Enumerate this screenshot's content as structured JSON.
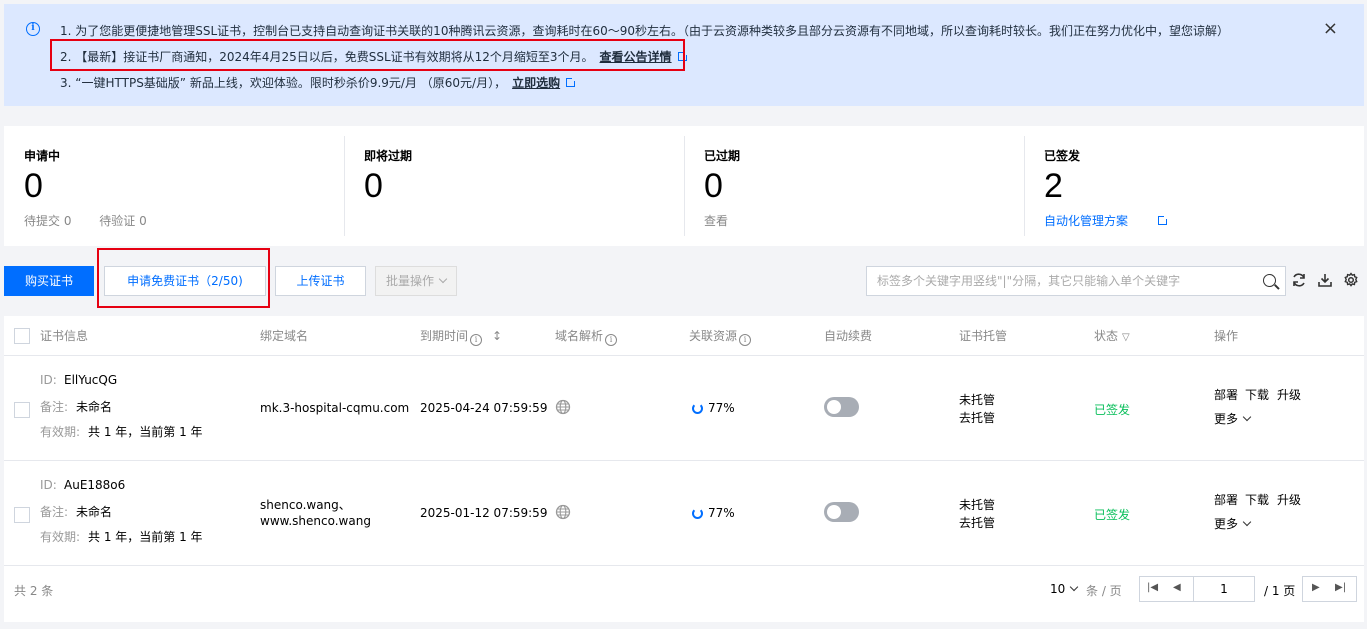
{
  "notice": {
    "line1": "1. 为了您能更便捷地管理SSL证书，控制台已支持自动查询证书关联的10种腾讯云资源，查询耗时在60～90秒左右。（由于云资源种类较多且部分云资源有不同地域，所以查询耗时较长。我们正在努力优化中，望您谅解）",
    "line2": "2. 【最新】接证书厂商通知，2024年4月25日以后，免费SSL证书有效期将从12个月缩短至3个月。",
    "line2_link": "查看公告详情",
    "line3": "3. “一键HTTPS基础版” 新品上线，欢迎体验。限时秒杀价9.9元/月 （原60元/月），",
    "line3_link": "立即选购",
    "close": "×"
  },
  "stats": [
    {
      "label": "申请中",
      "value": "0",
      "sub1": "待提交 0",
      "sub2": "待验证 0"
    },
    {
      "label": "即将过期",
      "value": "0"
    },
    {
      "label": "已过期",
      "value": "0",
      "sub1": "查看"
    },
    {
      "label": "已签发",
      "value": "2",
      "link": "自动化管理方案"
    }
  ],
  "toolbar": {
    "buy": "购买证书",
    "apply_free": "申请免费证书（2/50)",
    "upload": "上传证书",
    "batch": "批量操作",
    "search_placeholder": "标签多个关键字用竖线\"|\"分隔，其它只能输入单个关键字"
  },
  "table": {
    "headers": [
      "证书信息",
      "绑定域名",
      "到期时间",
      "域名解析",
      "关联资源",
      "自动续费",
      "证书托管",
      "状态",
      "操作"
    ],
    "labels": {
      "id": "ID:",
      "note": "备注:",
      "validity": "有效期:"
    },
    "rows": [
      {
        "id": "EllYucQG",
        "note": "未命名",
        "validity": "共 1 年，当前第 1 年",
        "domain1": "mk.3-hospital-cqmu.com",
        "domain2": "",
        "expire": "2025-04-24 07:59:59",
        "resource": "77%",
        "hosting": "未托管",
        "hosting_link": "去托管",
        "status": "已签发",
        "actions": [
          "部署",
          "下载",
          "升级",
          "更多"
        ]
      },
      {
        "id": "AuE188o6",
        "note": "未命名",
        "validity": "共 1 年，当前第 1 年",
        "domain1": "shenco.wang、",
        "domain2": "www.shenco.wang",
        "expire": "2025-01-12 07:59:59",
        "resource": "77%",
        "hosting": "未托管",
        "hosting_link": "去托管",
        "status": "已签发",
        "actions": [
          "部署",
          "下载",
          "升级",
          "更多"
        ]
      }
    ]
  },
  "footer": {
    "total": "共 2 条",
    "page_size": "10",
    "per_page": "条 / 页",
    "current_page": "1",
    "total_pages": "/ 1 页"
  },
  "colors": {
    "primary": "#006eff",
    "notice_bg": "#dce8ff",
    "success": "#0abf5b",
    "highlight": "#e60012"
  }
}
